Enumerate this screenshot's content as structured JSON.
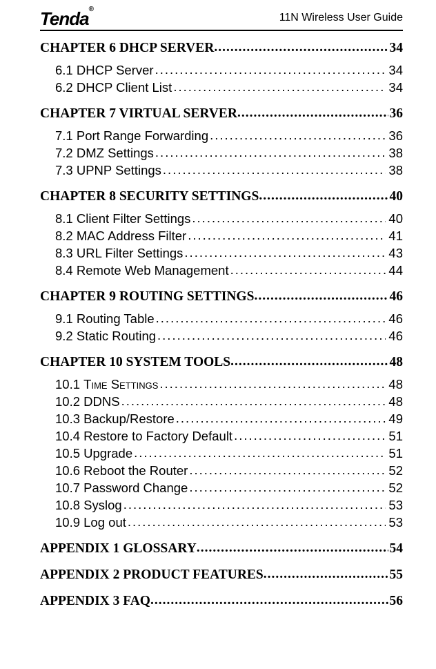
{
  "header": {
    "logo_text": "Tenda",
    "logo_mark": "®",
    "right_text": "11N Wireless User Guide"
  },
  "toc": [
    {
      "type": "chapter",
      "title": "CHAPTER 6 DHCP SERVER",
      "page": "34"
    },
    {
      "type": "entry",
      "title": "6.1 DHCP Server",
      "page": "34"
    },
    {
      "type": "entry",
      "title": "6.2 DHCP Client List",
      "page": "34"
    },
    {
      "type": "chapter",
      "title": "CHAPTER 7 VIRTUAL SERVER",
      "page": "36"
    },
    {
      "type": "entry",
      "title": "7.1 Port Range Forwarding",
      "page": "36"
    },
    {
      "type": "entry",
      "title": "7.2 DMZ Settings",
      "page": "38"
    },
    {
      "type": "entry",
      "title": "7.3 UPNP Settings",
      "page": "38"
    },
    {
      "type": "chapter",
      "title": "CHAPTER 8 SECURITY SETTINGS",
      "page": "40"
    },
    {
      "type": "entry",
      "title": "8.1 Client Filter Settings",
      "page": "40"
    },
    {
      "type": "entry",
      "title": "8.2 MAC Address Filter",
      "page": "41"
    },
    {
      "type": "entry",
      "title": "8.3 URL Filter Settings",
      "page": "43"
    },
    {
      "type": "entry",
      "title": "8.4 Remote Web Management",
      "page": "44"
    },
    {
      "type": "chapter",
      "title": "CHAPTER 9 ROUTING SETTINGS",
      "page": "46"
    },
    {
      "type": "entry",
      "title": "9.1 Routing Table",
      "page": "46"
    },
    {
      "type": "entry",
      "title": "9.2 Static Routing",
      "page": "46"
    },
    {
      "type": "chapter",
      "title": "CHAPTER 10 SYSTEM TOOLS",
      "page": "48"
    },
    {
      "type": "entry",
      "title": "10.1 Time Settings",
      "page": "48",
      "smallcaps_after": "10.1 "
    },
    {
      "type": "entry",
      "title": "10.2 DDNS",
      "page": "48"
    },
    {
      "type": "entry",
      "title": "10.3 Backup/Restore",
      "page": "49"
    },
    {
      "type": "entry",
      "title": "10.4 Restore to Factory Default",
      "page": "51"
    },
    {
      "type": "entry",
      "title": "10.5 Upgrade",
      "page": "51"
    },
    {
      "type": "entry",
      "title": "10.6 Reboot the Router",
      "page": "52"
    },
    {
      "type": "entry",
      "title": "10.7 Password Change",
      "page": "52"
    },
    {
      "type": "entry",
      "title": "10.8 Syslog",
      "page": "53"
    },
    {
      "type": "entry",
      "title": "10.9 Log out",
      "page": "53"
    },
    {
      "type": "chapter",
      "title": "APPENDIX 1 GLOSSARY",
      "page": "54"
    },
    {
      "type": "chapter",
      "title": "APPENDIX 2 PRODUCT FEATURES",
      "page": "55"
    },
    {
      "type": "chapter",
      "title": "APPENDIX 3 FAQ",
      "page": "56"
    }
  ]
}
